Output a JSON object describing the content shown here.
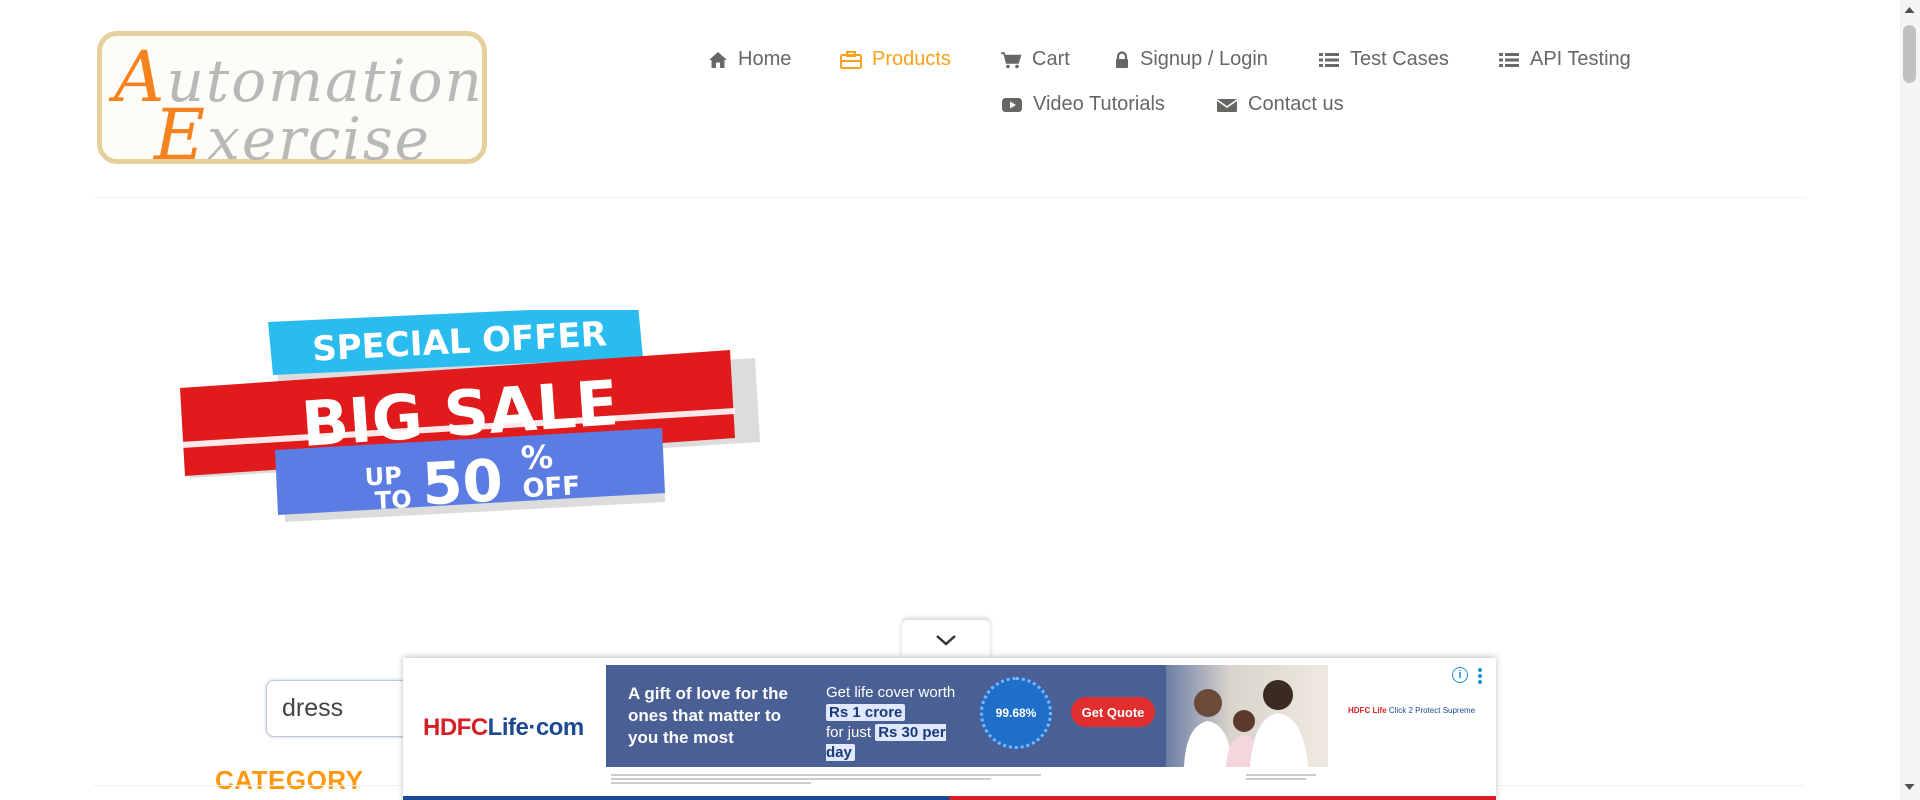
{
  "logo": {
    "line1_cap": "A",
    "line1_rest": "utomation",
    "line2_cap": "E",
    "line2_rest": "xercise"
  },
  "nav": {
    "items": [
      {
        "label": "Home",
        "icon": "home-icon"
      },
      {
        "label": "Products",
        "icon": "products-icon",
        "active": true
      },
      {
        "label": "Cart",
        "icon": "cart-icon"
      },
      {
        "label": "Signup / Login",
        "icon": "lock-icon"
      },
      {
        "label": "Test Cases",
        "icon": "list-icon"
      },
      {
        "label": "API Testing",
        "icon": "list-icon"
      },
      {
        "label": "Video Tutorials",
        "icon": "youtube-icon"
      },
      {
        "label": "Contact us",
        "icon": "envelope-icon"
      }
    ]
  },
  "banner": {
    "line1": "SPECIAL OFFER",
    "line2": "BIG SALE",
    "up": "UP",
    "to": "TO",
    "amount": "50",
    "percent": "%",
    "off": "OFF"
  },
  "search": {
    "value": "dress"
  },
  "sidebar": {
    "category_title": "CATEGORY"
  },
  "ad": {
    "brand_a": "HDFC",
    "brand_b": "Life",
    "brand_c": "·com",
    "headline": "A gift of love for the ones that matter to you the most",
    "cover_prefix": "Get life cover worth",
    "cover_amount": "Rs 1 crore",
    "cover_mid": "for just",
    "cover_price": "Rs 30 per day",
    "seal": "99.68%",
    "cta": "Get Quote",
    "side_brand": "HDFC Life",
    "side_product": "Click 2 Protect Supreme",
    "info": "i",
    "colors": {
      "red": "#d62027",
      "blue": "#1b4a93",
      "creative_bg": "#4a5f94"
    }
  },
  "colors": {
    "accent": "#f6a21b",
    "category": "#fe980f",
    "nav_text": "#696763"
  }
}
